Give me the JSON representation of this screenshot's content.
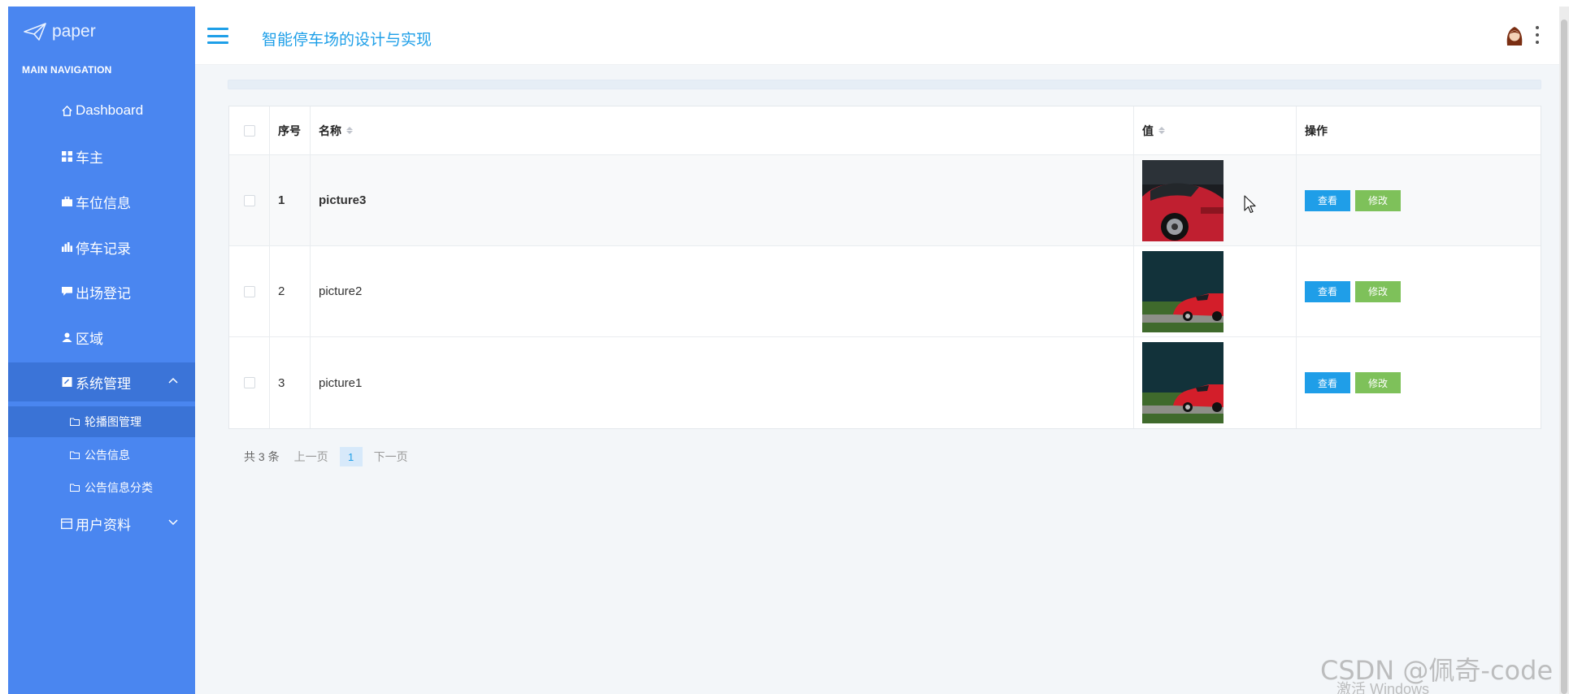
{
  "sidebar": {
    "logo_text": "paper",
    "section_title": "MAIN NAVIGATION",
    "items": [
      {
        "label": "Dashboard",
        "icon": "home-icon"
      },
      {
        "label": "车主",
        "icon": "grid-icon"
      },
      {
        "label": "车位信息",
        "icon": "briefcase-icon"
      },
      {
        "label": "停车记录",
        "icon": "bar-chart-icon"
      },
      {
        "label": "出场登记",
        "icon": "comment-icon"
      },
      {
        "label": "区域",
        "icon": "user-icon"
      },
      {
        "label": "系统管理",
        "icon": "edit-square-icon"
      },
      {
        "label": "用户资料",
        "icon": "calendar-icon"
      }
    ],
    "sub_items": [
      {
        "label": "轮播图管理",
        "icon": "folder-icon"
      },
      {
        "label": "公告信息",
        "icon": "folder-icon"
      },
      {
        "label": "公告信息分类",
        "icon": "folder-icon"
      }
    ]
  },
  "header": {
    "title": "智能停车场的设计与实现"
  },
  "table": {
    "columns": [
      "序号",
      "名称",
      "值",
      "操作"
    ],
    "rows": [
      {
        "num": "1",
        "name": "picture3",
        "image": "red-sports-car-front"
      },
      {
        "num": "2",
        "name": "picture2",
        "image": "red-sports-car-side"
      },
      {
        "num": "3",
        "name": "picture1",
        "image": "red-sports-car-side"
      }
    ],
    "view_label": "查看",
    "edit_label": "修改"
  },
  "pagination": {
    "total": "共 3 条",
    "prev": "上一页",
    "current": "1",
    "next": "下一页"
  },
  "watermark": {
    "csdn": "CSDN @佩奇-code",
    "windows": "激活 Windows"
  },
  "colors": {
    "sidebar": "#4a86f0",
    "sidebar_active": "#3b74d8",
    "accent": "#1e9fe8",
    "edit_button": "#7ec15a",
    "main_bg": "#f3f6f9"
  }
}
